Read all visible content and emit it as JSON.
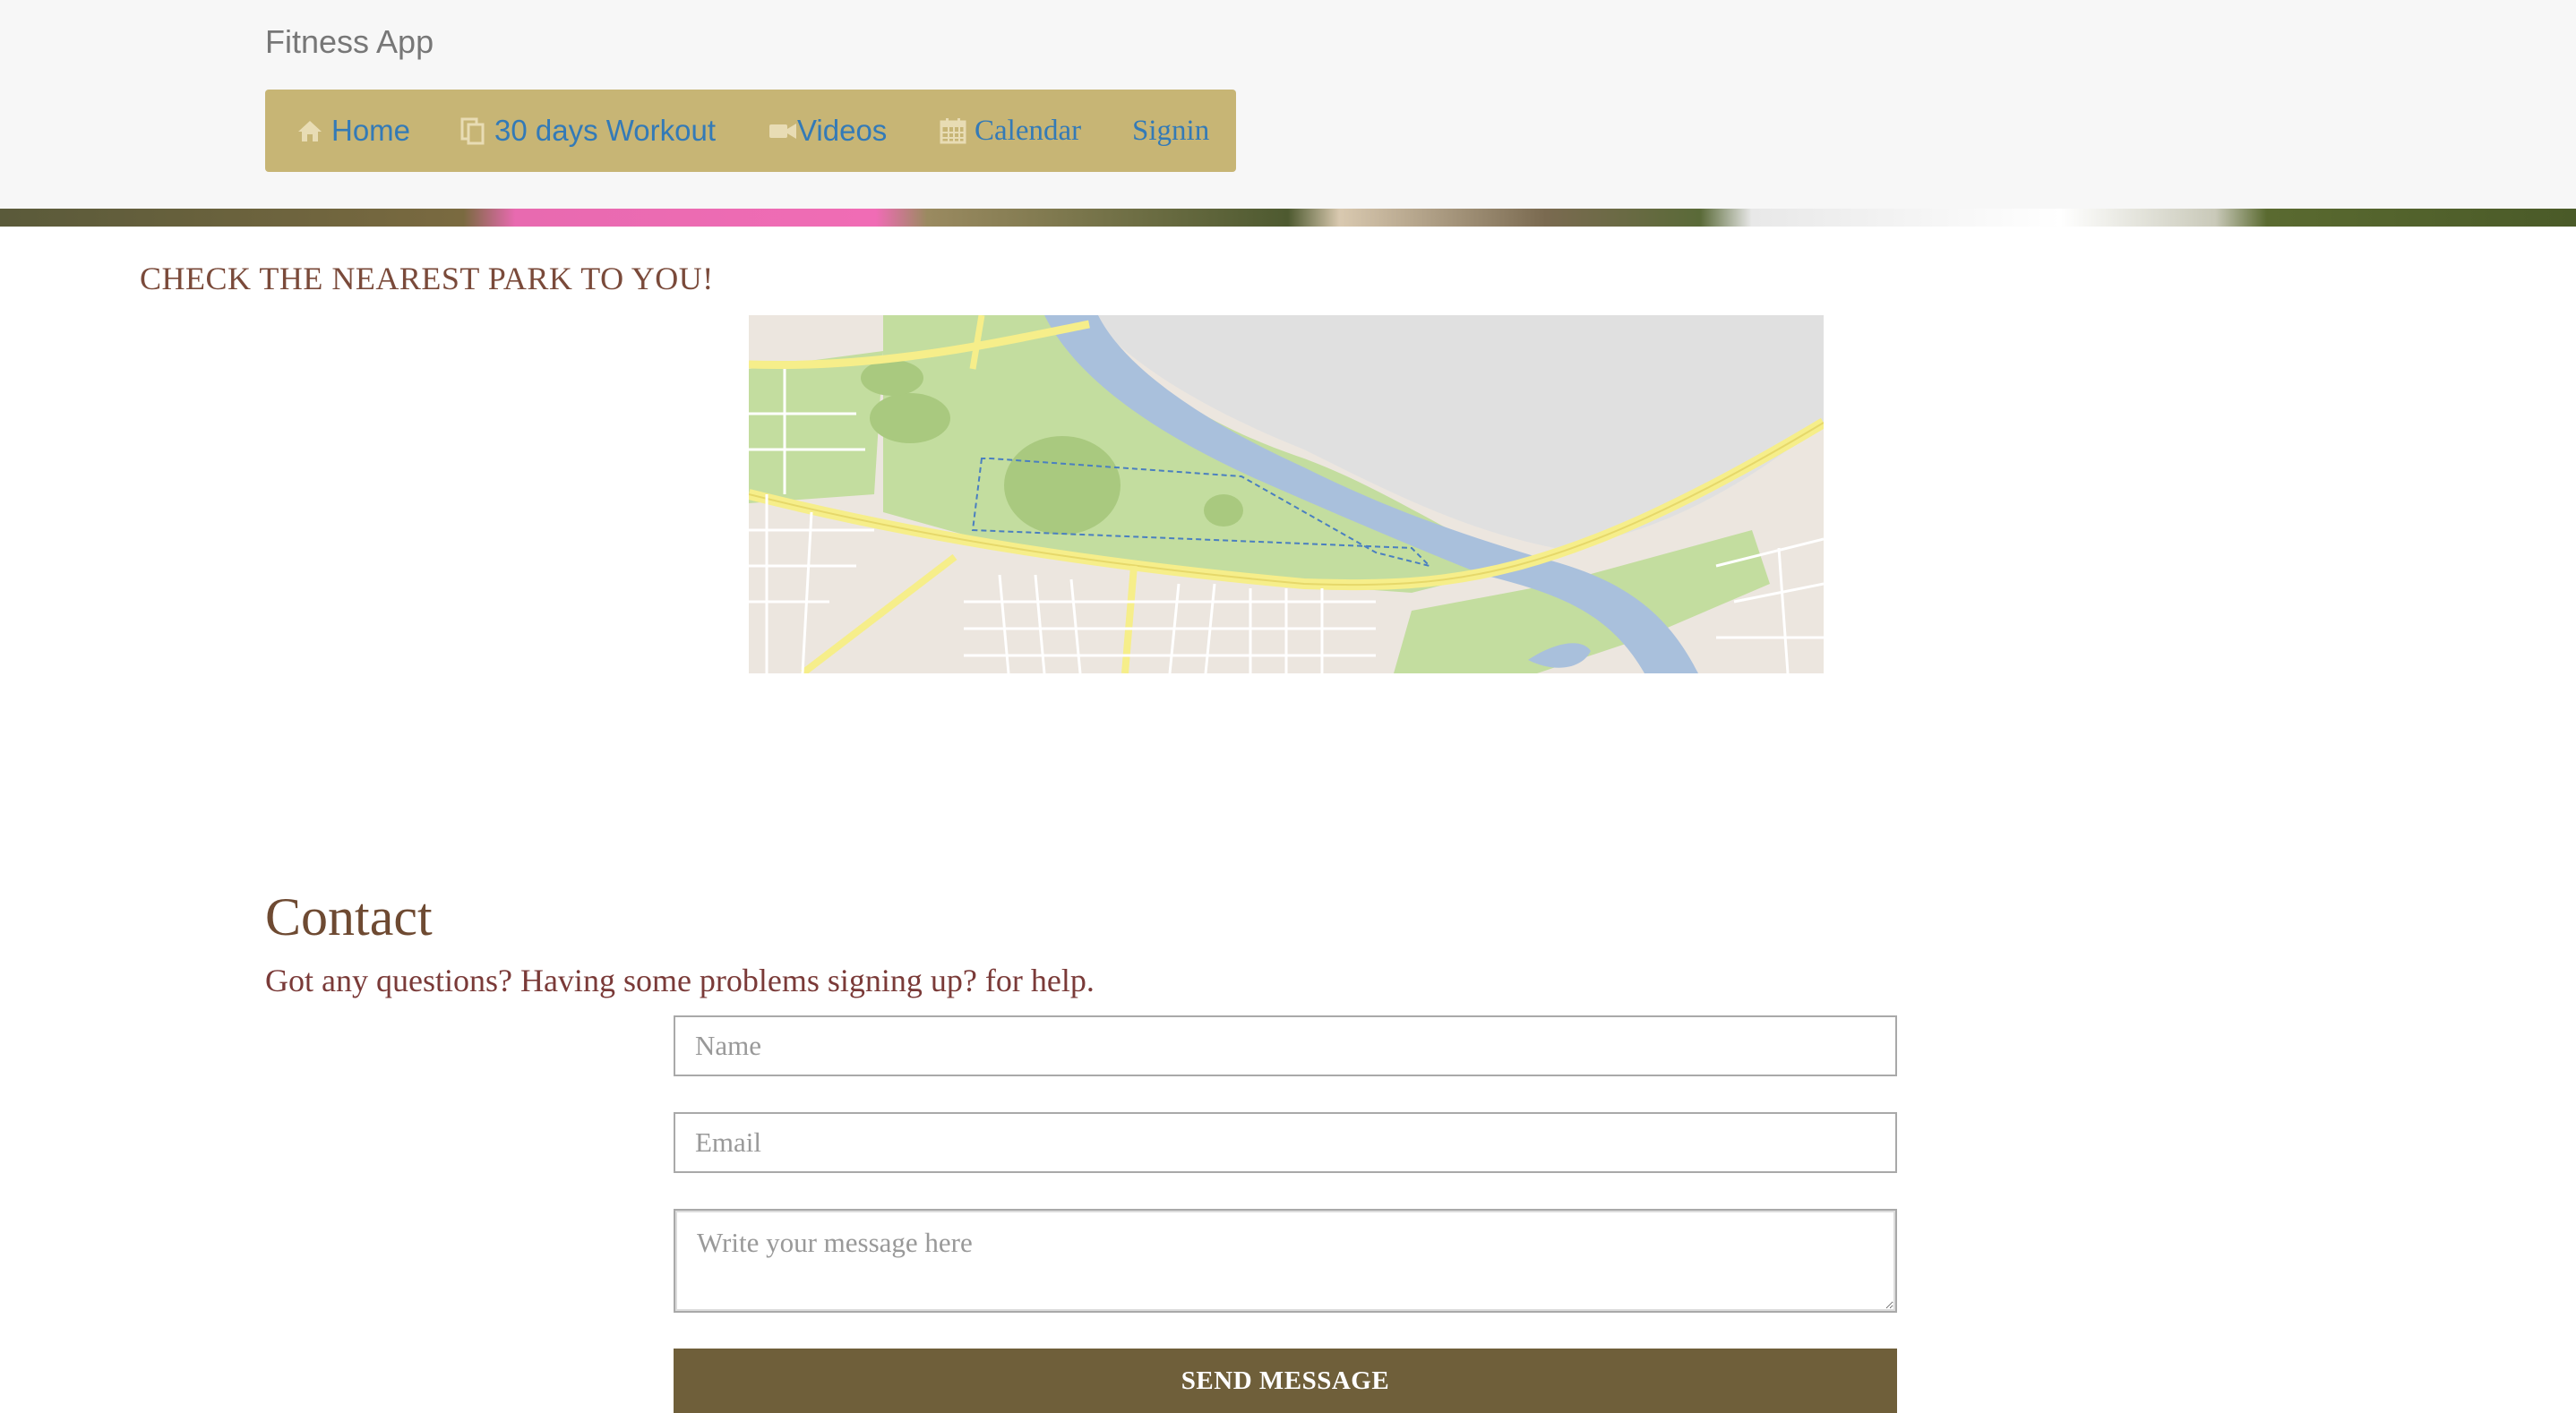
{
  "header": {
    "brand": "Fitness App",
    "nav": [
      {
        "label": "Home",
        "icon": "home-icon"
      },
      {
        "label": "30 days Workout",
        "icon": "file-icon"
      },
      {
        "label": "Videos",
        "icon": "video-camera-icon"
      },
      {
        "label": "Calendar",
        "icon": "calendar-icon"
      },
      {
        "label": "Signin",
        "icon": ""
      }
    ]
  },
  "park": {
    "title": "CHECK THE NEAREST PARK TO YOU!"
  },
  "contact": {
    "title": "Contact",
    "subtitle": "Got any questions? Having some problems signing up? for help.",
    "name_placeholder": "Name",
    "email_placeholder": "Email",
    "message_placeholder": "Write your message here",
    "send_label": "SEND MESSAGE"
  },
  "colors": {
    "navbar": "#c7b575",
    "nav_link": "#337ab7",
    "button": "#6f5f3a",
    "heading": "#6e4a32"
  }
}
